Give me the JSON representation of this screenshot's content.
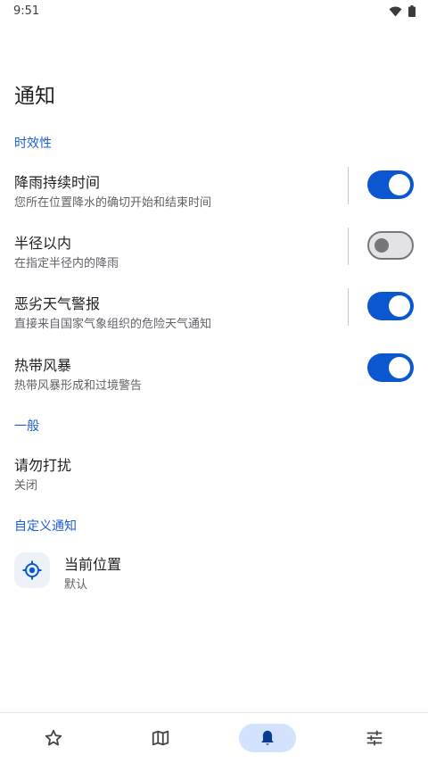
{
  "status": {
    "time": "9:51"
  },
  "page": {
    "title": "通知"
  },
  "sections": {
    "timeliness": "时效性",
    "general": "一般",
    "custom": "自定义通知"
  },
  "items": [
    {
      "title": "降雨持续时间",
      "subtitle": "您所在位置降水的确切开始和结束时间",
      "enabled": true
    },
    {
      "title": "半径以内",
      "subtitle": "在指定半径内的降雨",
      "enabled": false
    },
    {
      "title": "恶劣天气警报",
      "subtitle": "直接来自国家气象组织的危险天气通知",
      "enabled": true
    },
    {
      "title": "热带风暴",
      "subtitle": "热带风暴形成和过境警告",
      "enabled": true
    }
  ],
  "dnd": {
    "title": "请勿打扰",
    "value": "关闭"
  },
  "location": {
    "title": "当前位置",
    "value": "默认",
    "icon": "my-location-icon"
  },
  "nav": [
    {
      "icon": "star-icon",
      "active": false
    },
    {
      "icon": "map-icon",
      "active": false
    },
    {
      "icon": "bell-icon",
      "active": true
    },
    {
      "icon": "tune-icon",
      "active": false
    }
  ],
  "colors": {
    "accent": "#0b57d0",
    "section": "#1a5fd0",
    "activeNav": "#d3e3fd"
  }
}
